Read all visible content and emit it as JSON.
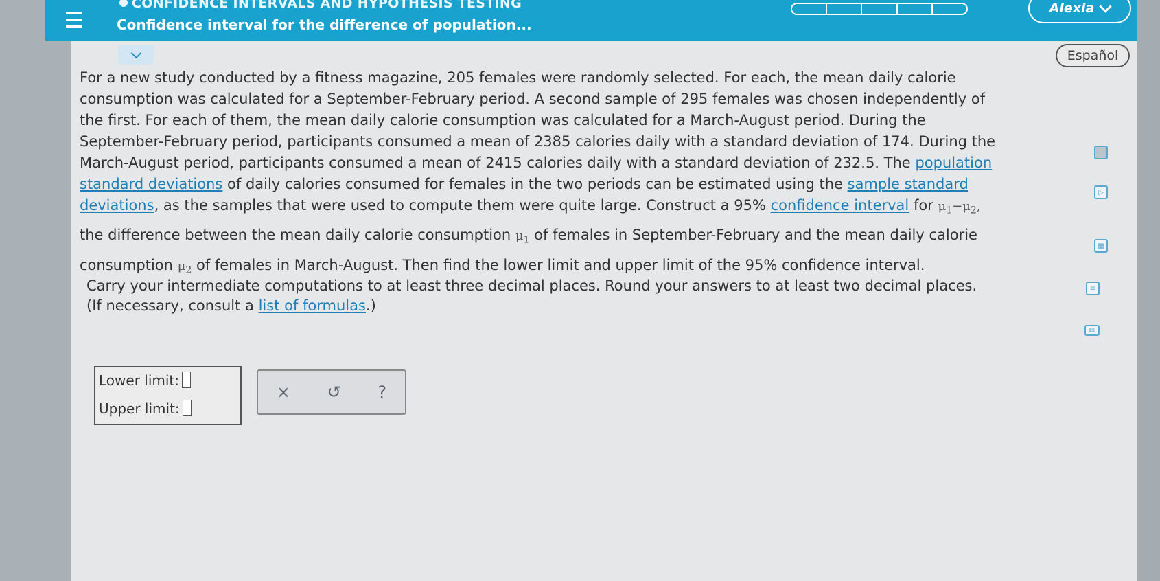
{
  "header": {
    "topic": "CONFIDENCE INTERVALS AND HYPOTHESIS TESTING",
    "subtitle": "Confidence interval for the difference of population...",
    "user_name": "Alexia",
    "progress_segments": 5
  },
  "language_button": "Español",
  "problem": {
    "lines": [
      "For a new study conducted by a fitness magazine, 205 females were randomly selected. For each, the mean daily calorie",
      "consumption was calculated for a September-February period. A second sample of 295 females was chosen independently of",
      "the first. For each of them, the mean daily calorie consumption was calculated for a March-August period. During the",
      "September-February period, participants consumed a mean of 2385 calories daily with a standard deviation of 174. During the"
    ],
    "line5_pre": "March-August period, participants consumed a mean of 2415 calories daily with a standard deviation of 232.5. The ",
    "link_population": "population",
    "link_standard_deviations": "standard deviations",
    "line6_mid": " of daily calories consumed for females in the two periods can be estimated using the ",
    "link_sample_standard": "sample standard",
    "link_deviations": "deviations",
    "line7_mid": ", as the samples that were used to compute them were quite large. Construct a 95% ",
    "link_confidence_interval": "confidence interval",
    "line7_for": " for ",
    "mu": "μ",
    "sub1": "1",
    "sub2": "2",
    "minus": "−",
    "comma": ",",
    "line8_pre": "the difference between the mean daily calorie consumption ",
    "line8_post": " of females in September-February and the mean daily calorie",
    "line9_pre": "consumption ",
    "line9_post": " of females in March-August. Then find the lower limit and upper limit of the 95% confidence interval."
  },
  "instructions": {
    "line1": "Carry your intermediate computations to at least three decimal places. Round your answers to at least two decimal places.",
    "line2_pre": "(If necessary, consult a ",
    "link_formulas": "list of formulas",
    "line2_post": ".)"
  },
  "answers": {
    "lower_label": "Lower limit:",
    "upper_label": "Upper limit:"
  },
  "actions": {
    "clear": "×",
    "undo": "↺",
    "help": "?"
  },
  "side_tools": [
    "calculator-icon",
    "video-icon",
    "data-table-icon",
    "glossary-icon",
    "mail-icon"
  ]
}
